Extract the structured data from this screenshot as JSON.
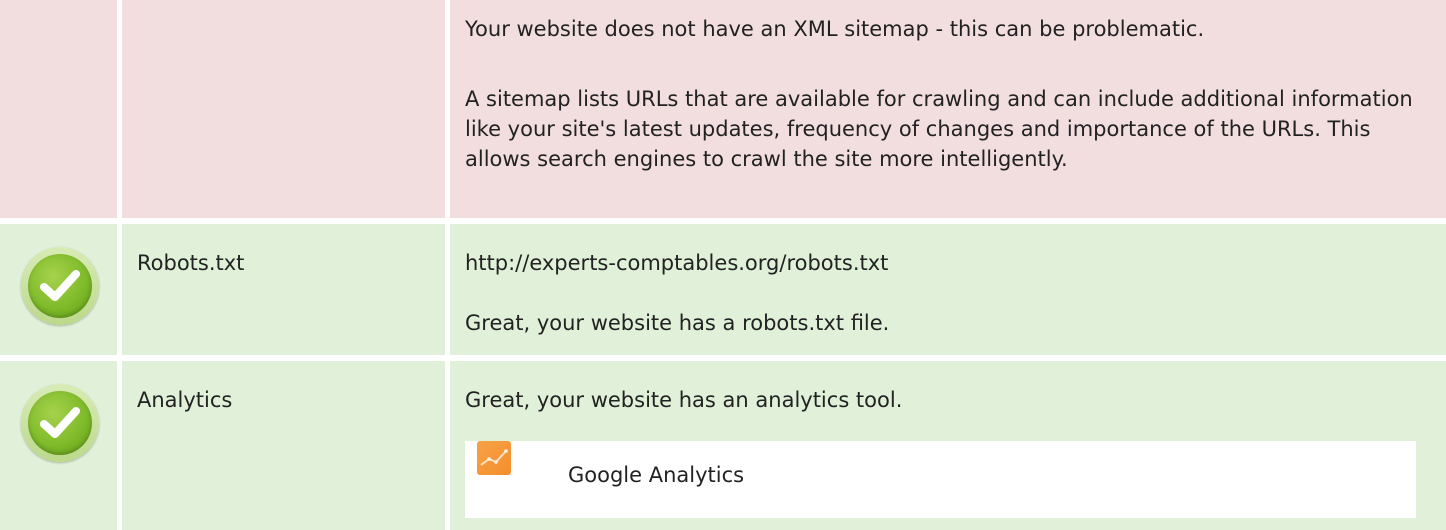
{
  "sitemap": {
    "status": "error",
    "label": "",
    "message": "Your website does not have an XML sitemap - this can be problematic.",
    "description": "A sitemap lists URLs that are available for crawling and can include additional information like your site's latest updates, frequency of changes and importance of the URLs. This allows search engines to crawl the site more intelligently."
  },
  "robots": {
    "status": "ok",
    "icon": "check-circle-icon",
    "label": "Robots.txt",
    "url": "http://experts-comptables.org/robots.txt",
    "message": "Great, your website has a robots.txt file."
  },
  "analytics": {
    "status": "ok",
    "icon": "check-circle-icon",
    "label": "Analytics",
    "message": "Great, your website has an analytics tool.",
    "tools": [
      {
        "name": "Google Analytics",
        "icon": "google-analytics-icon"
      }
    ]
  },
  "colors": {
    "error_bg": "#f2dede",
    "success_bg": "#e0f0d9",
    "check_green": "#7fbb2a",
    "ga_orange": "#f48f2a"
  }
}
